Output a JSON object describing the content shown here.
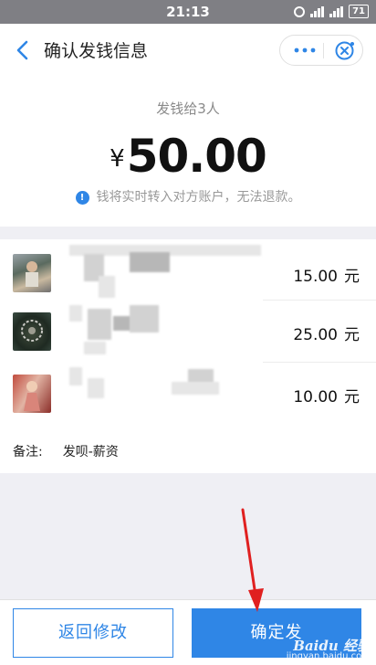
{
  "status_bar": {
    "time": "21:13",
    "battery": "71"
  },
  "nav": {
    "title": "确认发钱信息",
    "back_icon": "chevron-left-icon",
    "more_icon": "more-icon",
    "close_icon": "close-icon"
  },
  "summary": {
    "recipient_count": "发钱给3人",
    "currency": "¥",
    "amount": "50.00",
    "notice": "钱将实时转入对方账户，无法退款。"
  },
  "recipients": [
    {
      "amount": "15.00",
      "unit": "元"
    },
    {
      "amount": "25.00",
      "unit": "元"
    },
    {
      "amount": "10.00",
      "unit": "元"
    }
  ],
  "memo": {
    "label": "备注:",
    "value": "发呗-薪资"
  },
  "buttons": {
    "back": "返回修改",
    "confirm": "确定发"
  },
  "watermark": {
    "logo": "Baidu 经验",
    "url": "jingyan.baidu.com"
  },
  "colors": {
    "accent": "#2f86e6",
    "annotation": "#e02020"
  }
}
